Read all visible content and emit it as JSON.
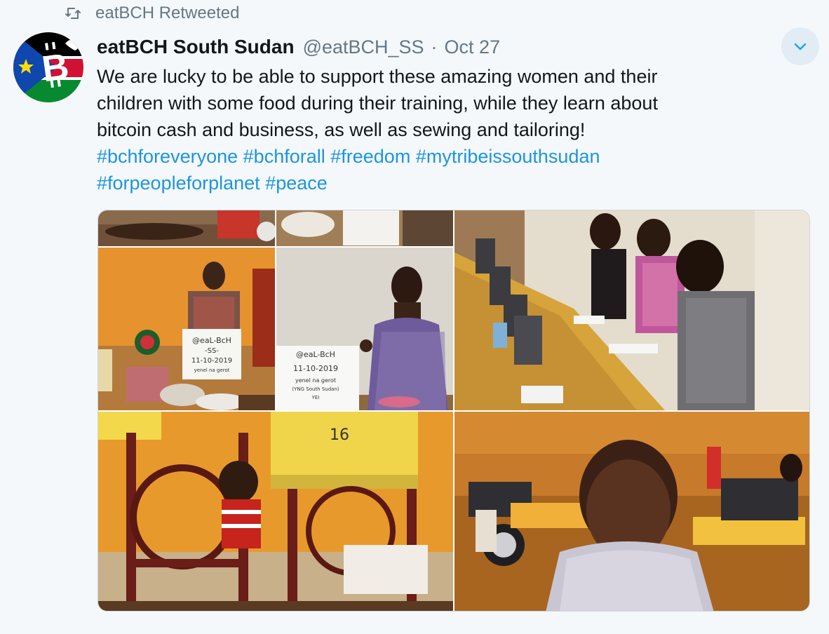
{
  "retweet": {
    "icon": "retweet-icon",
    "label": "eatBCH Retweeted"
  },
  "author": {
    "display_name": "eatBCH South Sudan",
    "handle": "@eatBCH_SS",
    "separator": "·",
    "date": "Oct 27",
    "avatar_icon": "eatbch-south-sudan-flag-logo"
  },
  "menu": {
    "icon": "chevron-down-icon"
  },
  "tweet": {
    "body_lines": [
      "We are lucky to be able to support these amazing women and their",
      "children with some food during their training, while they learn about",
      "bitcoin cash and business, as well as sewing and tailoring!"
    ],
    "hashtags_line1": [
      "#bchforeveryone",
      "#bchforall",
      "#freedom",
      "#mytribeissouthsudan"
    ],
    "hashtags_line2": [
      "#forpeopleforplanet",
      "#peace"
    ]
  },
  "media": {
    "sign_text": [
      "@eaL-BcH",
      "-SS-",
      "11-10-2019",
      "yenel na gerot",
      "(YNG South Sudan)",
      "YEI"
    ],
    "desk_number": "16"
  },
  "colors": {
    "link": "#1b95e0",
    "muted": "#657786",
    "background": "#f5f8fa",
    "chevron_bg": "#e1ecf4",
    "chevron": "#1da1f2"
  }
}
